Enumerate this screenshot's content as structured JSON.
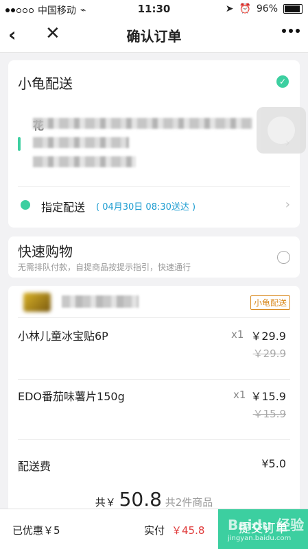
{
  "status_bar": {
    "carrier": "中国移动",
    "time": "11:30",
    "battery": "96%"
  },
  "nav": {
    "title": "确认订单"
  },
  "delivery_card": {
    "label": "小龟配送",
    "address_line1": "花",
    "address_line2": "",
    "address_line3": "",
    "scheduled_label": "指定配送",
    "scheduled_time": "( 04月30日 08:30送达 )"
  },
  "fast_buy": {
    "label": "快速购物",
    "sub": "无需排队付款，自提商品按提示指引，快速通行"
  },
  "store": {
    "tag": "小龟配送",
    "items": [
      {
        "name": "小林儿童冰宝贴6P",
        "qty": "x1",
        "price": "￥29.9",
        "original": "￥29.9"
      },
      {
        "name": "EDO番茄味薯片150g",
        "qty": "x1",
        "price": "￥15.9",
        "original": "￥15.9"
      }
    ],
    "fee_label": "配送费",
    "fee_value": "¥5.0",
    "total_prefix": "共￥",
    "total_value": "50.8",
    "total_suffix": "共2件商品"
  },
  "bottom": {
    "discount": "已优惠￥5",
    "pay_label": "实付",
    "pay_value": "￥45.8",
    "submit": "提交订单"
  },
  "watermark": {
    "brand": "Baidu 经验",
    "url": "jingyan.baidu.com"
  }
}
